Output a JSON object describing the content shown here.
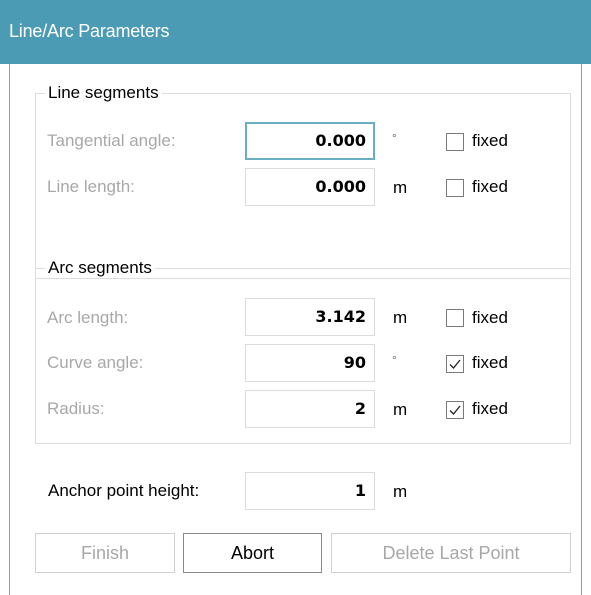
{
  "window": {
    "title": "Line/Arc Parameters"
  },
  "line_segments": {
    "title": "Line segments",
    "tangential_angle": {
      "label": "Tangential angle:",
      "value": "0.000",
      "unit": "°",
      "fixed_label": "fixed",
      "fixed": false
    },
    "line_length": {
      "label": "Line length:",
      "value": "0.000",
      "unit": "m",
      "fixed_label": "fixed",
      "fixed": false
    }
  },
  "arc_segments": {
    "title": "Arc segments",
    "arc_length": {
      "label": "Arc length:",
      "value": "3.142",
      "unit": "m",
      "fixed_label": "fixed",
      "fixed": false
    },
    "curve_angle": {
      "label": "Curve angle:",
      "value": "90",
      "unit": "°",
      "fixed_label": "fixed",
      "fixed": true
    },
    "radius": {
      "label": "Radius:",
      "value": "2",
      "unit": "m",
      "fixed_label": "fixed",
      "fixed": true
    }
  },
  "anchor": {
    "label": "Anchor point height:",
    "value": "1",
    "unit": "m"
  },
  "buttons": {
    "finish": "Finish",
    "abort": "Abort",
    "delete_last": "Delete Last Point"
  },
  "colors": {
    "titlebar": "#4a9bb3",
    "focus_border": "#6aaec2",
    "disabled_text": "#a8a8a8"
  }
}
